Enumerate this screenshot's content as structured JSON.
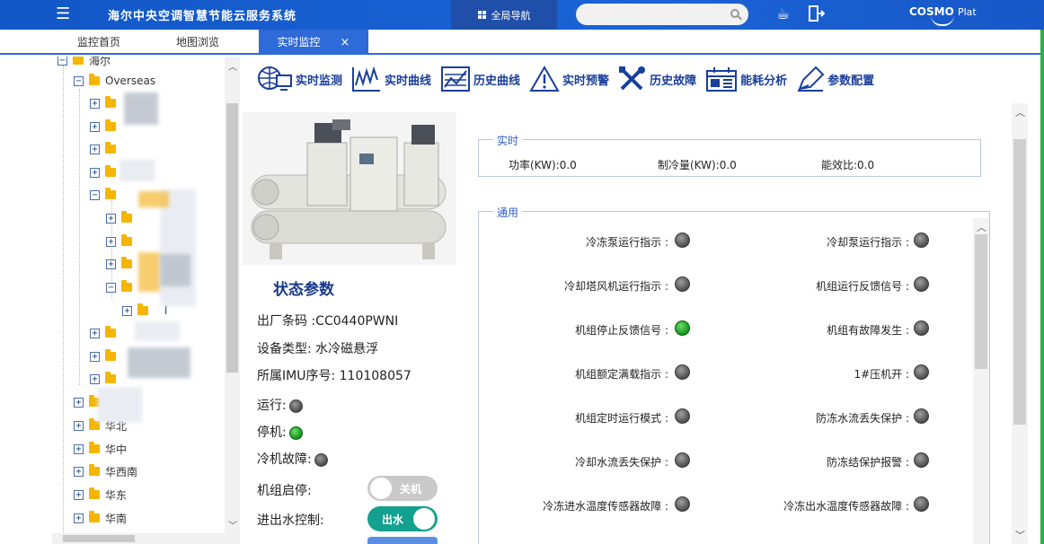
{
  "header": {
    "menu_icon": "menu-icon",
    "title": "海尔中央空调智慧节能云服务系统",
    "global_nav_label": "全局导航",
    "search_placeholder": "",
    "brand_name": "COSMO",
    "brand_suffix": "Plat"
  },
  "tabs": [
    {
      "label": "监控首页",
      "active": false
    },
    {
      "label": "地图浏览",
      "active": false
    },
    {
      "label": "实时监控",
      "active": true,
      "close": "×"
    }
  ],
  "sidebar": {
    "root_label": "海尔",
    "overseas_label": "Overseas",
    "regions": [
      "华北",
      "华中",
      "华西南",
      "华东",
      "华南"
    ],
    "sub_leaf_label": "l"
  },
  "toolbar": [
    {
      "label": "实时监测",
      "icon": "globe-monitor-icon"
    },
    {
      "label": "实时曲线",
      "icon": "line-chart-icon"
    },
    {
      "label": "历史曲线",
      "icon": "history-chart-icon"
    },
    {
      "label": "实时预警",
      "icon": "warning-icon"
    },
    {
      "label": "历史故障",
      "icon": "tools-icon"
    },
    {
      "label": "能耗分析",
      "icon": "energy-icon"
    },
    {
      "label": "参数配置",
      "icon": "pencil-icon"
    }
  ],
  "status": {
    "title": "状态参数",
    "serial_label": "出厂条码 :",
    "serial_value": "CC0440PWNI",
    "type_label": "设备类型:",
    "type_value": "水冷磁悬浮",
    "imu_label": "所属IMU序号:",
    "imu_value": "110108057",
    "running_label": "运行:",
    "stopped_label": "停机:",
    "fault_label": "冷机故障:",
    "start_stop_label": "机组启停:",
    "start_stop_toggle": "关机",
    "water_label": "进出水控制:",
    "water_toggle": "出水"
  },
  "realtime": {
    "legend": "实时",
    "power": "功率(KW):0.0",
    "cooling": "制冷量(KW):0.0",
    "efficiency": "能效比:0.0"
  },
  "general": {
    "legend": "通用",
    "signals": [
      {
        "left": "冷冻泵运行指示 :",
        "left_on": false,
        "right": "冷却泵运行指示 :",
        "right_on": false
      },
      {
        "left": "冷却塔风机运行指示 :",
        "left_on": false,
        "right": "机组运行反馈信号 :",
        "right_on": false
      },
      {
        "left": "机组停止反馈信号 :",
        "left_on": true,
        "right": "机组有故障发生 :",
        "right_on": false
      },
      {
        "left": "机组额定满载指示 :",
        "left_on": false,
        "right": "1#压机开 :",
        "right_on": false
      },
      {
        "left": "机组定时运行模式 :",
        "left_on": false,
        "right": "防冻水流丢失保护 :",
        "right_on": false
      },
      {
        "left": "冷却水流丢失保护 :",
        "left_on": false,
        "right": "防冻结保护报警 :",
        "right_on": false
      },
      {
        "left": "冷冻进水温度传感器故障 :",
        "left_on": false,
        "right": "冷冻出水温度传感器故障 :",
        "right_on": false
      }
    ]
  },
  "colors": {
    "header_blue": "#1a63d6",
    "tab_active": "#2e6ad8",
    "led_green": "#1e9e24",
    "toggle_on": "#14a08f",
    "toolbar_text": "#1a3f9c"
  }
}
